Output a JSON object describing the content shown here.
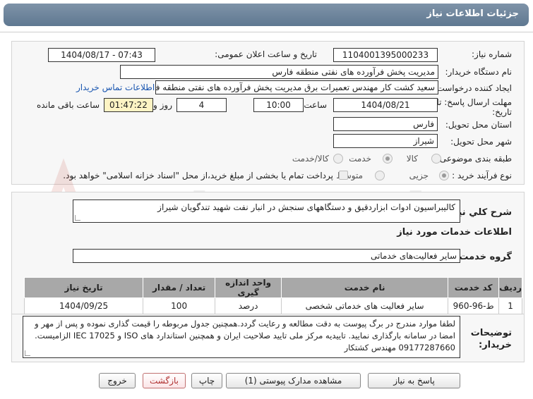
{
  "header": {
    "title": "جزئیات اطلاعات نیاز"
  },
  "fields": {
    "need_number_label": "شماره نیاز:",
    "need_number": "1104001395000233",
    "announce_label": "تاریخ و ساعت اعلان عمومی:",
    "announce_value": "1404/08/17 - 07:43",
    "buyer_org_label": "نام دستگاه خریدار:",
    "buyer_org": "مدیریت پخش فرآورده های نفتی منطقه فارس",
    "creator_label": "ایجاد کننده درخواست:",
    "creator": "سعید کشت کار مهندس تعمیرات برق مدیریت پخش فرآورده های نفتی منطقه فا",
    "contact_link": "اطلاعات تماس خریدار",
    "deadline_label_1": "مهلت ارسال پاسخ: تا",
    "deadline_label_2": "تاریخ:",
    "deadline_date": "1404/08/21",
    "time_label": "ساعت",
    "deadline_time": "10:00",
    "days_value": "4",
    "days_label": "روز و",
    "remaining_time": "01:47:22",
    "remaining_label": "ساعت باقی مانده",
    "province_label": "استان محل تحویل:",
    "province": "فارس",
    "city_label": "شهر محل تحویل:",
    "city": "شیراز",
    "category_label": "طبقه بندی موضوعی:",
    "category_options": [
      "کالا",
      "خدمت",
      "کالا/خدمت"
    ],
    "process_label": "نوع فرآیند خرید :",
    "process_options": [
      "جزیی",
      "متوسط"
    ],
    "payment_note": "پرداخت تمام یا بخشی از مبلغ خرید،از محل \"اسناد خزانه اسلامی\" خواهد بود."
  },
  "need_summary": {
    "label": "شرح کلي نياز:",
    "text": "کالیبراسیون ادوات ابزاردقیق و دستگاههای سنجش در انبار نفت شهید تندگویان شیراز"
  },
  "services": {
    "section_title": "اطلاعات خدمات مورد نیاز",
    "group_label": "گروه خدمت:",
    "group_value": "سایر فعالیت‌های خدماتی",
    "columns": [
      "ردیف",
      "کد خدمت",
      "نام خدمت",
      "واحد اندازه گیری",
      "تعداد / مقدار",
      "تاریخ نیاز"
    ],
    "rows": [
      [
        "1",
        "ط-96-960",
        "سایر فعالیت های خدماتی شخصی",
        "درصد",
        "100",
        "1404/09/25"
      ]
    ]
  },
  "buyer_notes": {
    "label_1": "توضیحات",
    "label_2": "خریدار:",
    "line1": "لطفا موارد مندرج در برگ پیوست به دقت مطالعه و رعایت گردد.همچنین جدول مربوطه را قیمت گذاری نموده و پس از مهر و",
    "line2": "امضا در سامانه بارگذاری نمایید. تاییدیه مرکز ملی تایید صلاحیت ایران و همچنین استاندارد های ISO و  IEC 17025 الزامیست.",
    "line3": "09177287660 مهندس کشتکار"
  },
  "buttons": {
    "reply": "پاسخ به نیاز",
    "attachments": "مشاهده مدارک پیوستی (1)",
    "print": "چاپ",
    "back": "بازگشت",
    "exit": "خروج"
  },
  "watermark_text": "AriaTender.net"
}
